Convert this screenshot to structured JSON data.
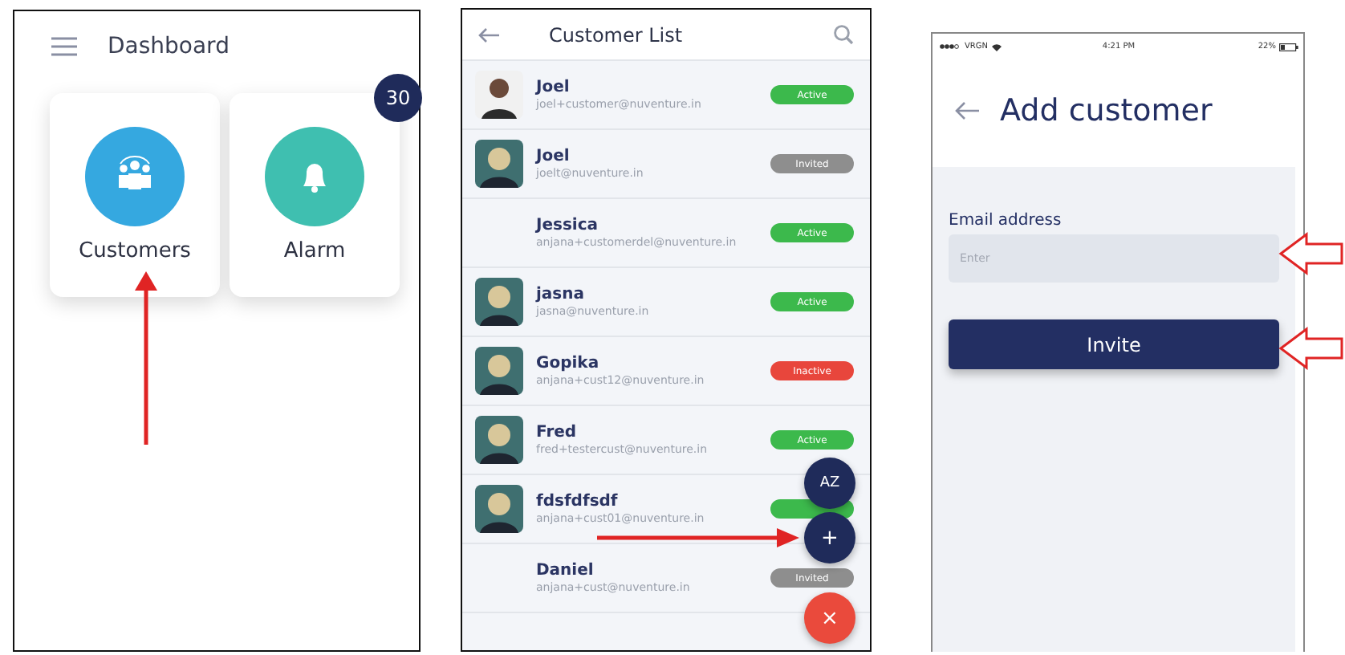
{
  "dashboard": {
    "title": "Dashboard",
    "tiles": [
      {
        "label": "Customers",
        "color": "#35a8e0"
      },
      {
        "label": "Alarm",
        "color": "#3fbfb0",
        "badge": "30"
      }
    ]
  },
  "customer_list": {
    "title": "Customer List",
    "rows": [
      {
        "kind": "photo",
        "name": "Joel",
        "email": "joel+customer@nuventure.in",
        "color": "#3cb94c",
        "status_label": "Active"
      },
      {
        "kind": "drawing",
        "name": "Joel",
        "email": "joelt@nuventure.in",
        "color": "#8e8e8e",
        "status_label": "Invited"
      },
      {
        "kind": "plain",
        "name": "Jessica",
        "email": "anjana+customerdel@nuventure.in",
        "color": "#3cb94c",
        "status_label": "Active"
      },
      {
        "kind": "drawing",
        "name": "jasna",
        "email": "jasna@nuventure.in",
        "color": "#3cb94c",
        "status_label": "Active"
      },
      {
        "kind": "drawing",
        "name": "Gopika",
        "email": "anjana+cust12@nuventure.in",
        "color": "#e8463c",
        "status_label": "Inactive"
      },
      {
        "kind": "drawing",
        "name": "Fred",
        "email": "fred+testercust@nuventure.in",
        "color": "#3cb94c",
        "status_label": "Active"
      },
      {
        "kind": "drawing",
        "name": "fdsfdfsdf",
        "email": "anjana+cust01@nuventure.in",
        "color": "#3cb94c"
      },
      {
        "kind": "plain",
        "name": "Daniel",
        "email": "anjana+cust@nuventure.in",
        "color": "#8e8e8e",
        "status_label": "Invited"
      }
    ],
    "fabs": [
      {
        "kind": "sort",
        "label": "AZ"
      },
      {
        "kind": "add",
        "label": "+"
      },
      {
        "kind": "close",
        "label": "×"
      }
    ]
  },
  "add_customer": {
    "status_bar": {
      "carrier": "VRGN",
      "time": "4:21 PM",
      "battery": "22%"
    },
    "title": "Add customer",
    "email_label": "Email address",
    "email_placeholder": "Enter",
    "button": "Invite"
  }
}
